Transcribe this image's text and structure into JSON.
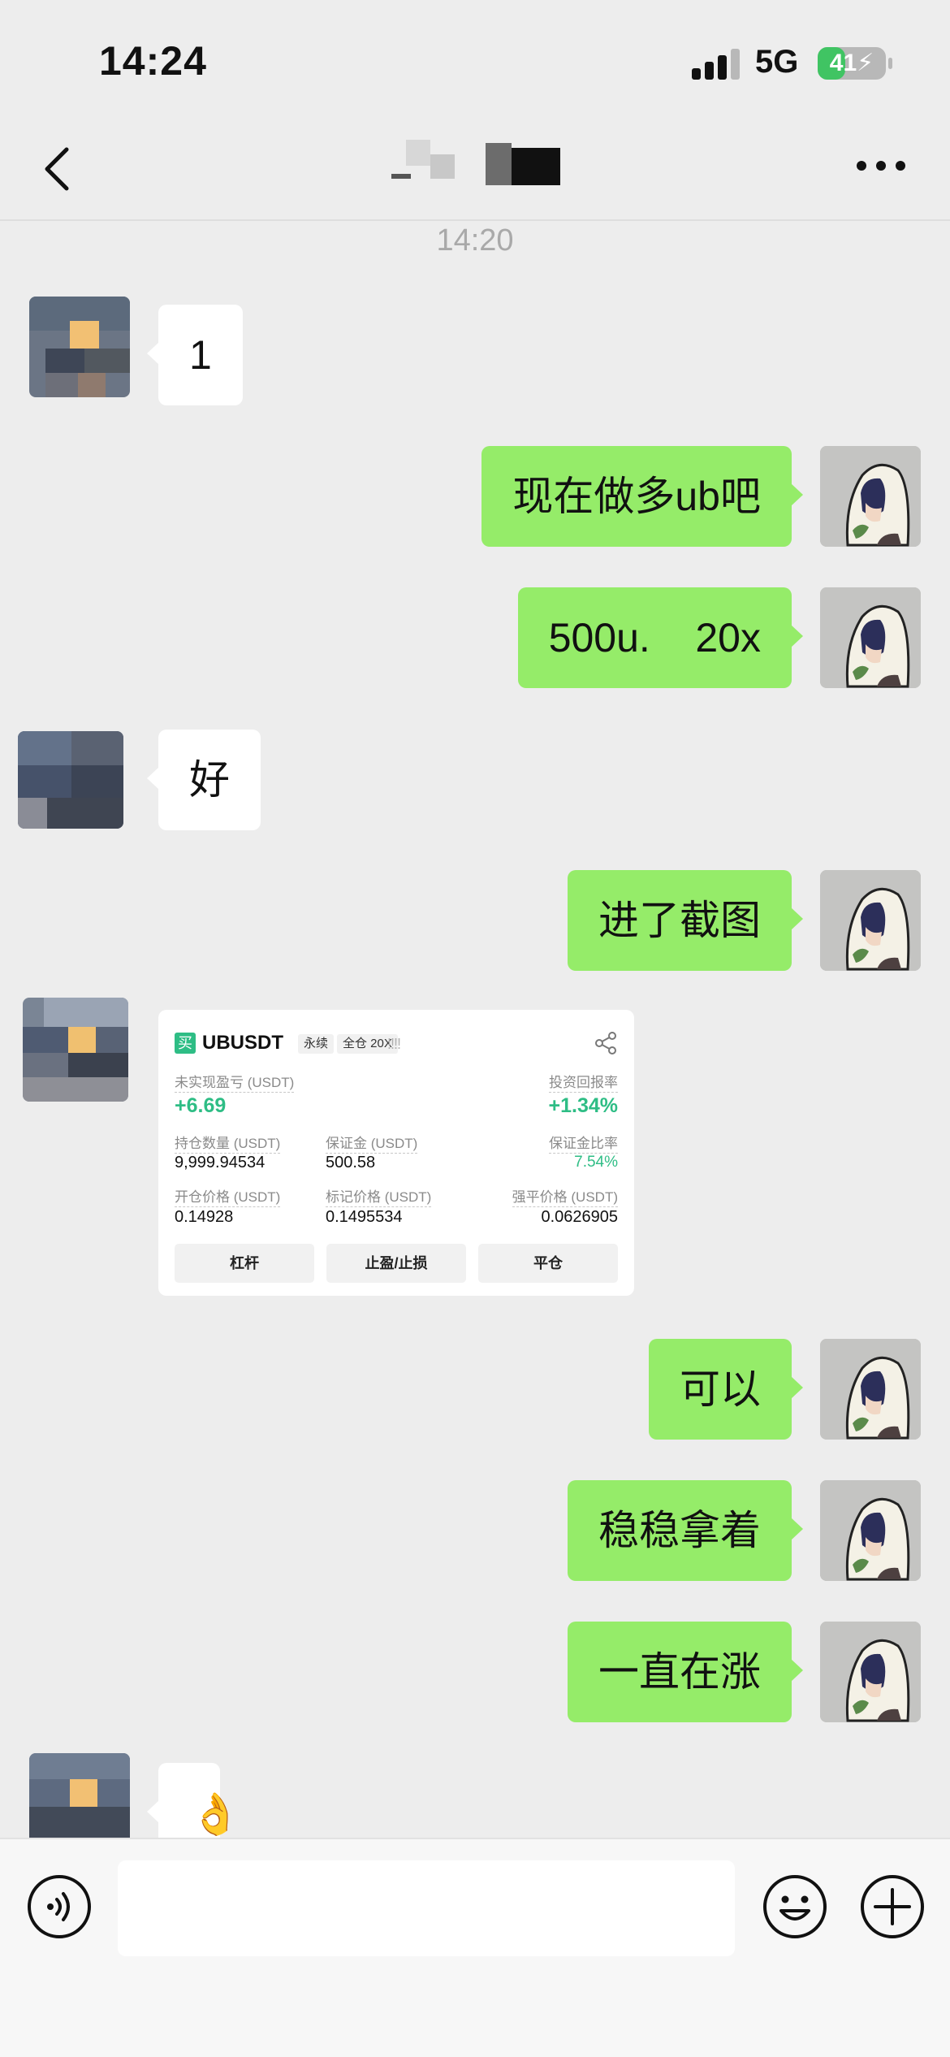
{
  "status_bar": {
    "time": "14:24",
    "network": "5G",
    "battery_level": "41",
    "battery_color": "#40c463"
  },
  "nav": {
    "back_icon": "chevron-left-icon",
    "more_icon": "more-icon"
  },
  "chat": {
    "timestamp": "14:20",
    "bubble_colors": {
      "incoming": "#ffffff",
      "outgoing": "#95ec69"
    },
    "messages": [
      {
        "side": "in",
        "text": "1"
      },
      {
        "side": "out",
        "text": "现在做多ub吧"
      },
      {
        "side": "out",
        "text": "500u.    20x"
      },
      {
        "side": "in",
        "text": "好"
      },
      {
        "side": "out",
        "text": "进了截图"
      },
      {
        "side": "in",
        "type": "image"
      },
      {
        "side": "out",
        "text": "可以"
      },
      {
        "side": "out",
        "text": "稳稳拿着"
      },
      {
        "side": "out",
        "text": "一直在涨"
      },
      {
        "side": "in",
        "text": "👌"
      }
    ]
  },
  "position_card": {
    "side_tag": "买",
    "symbol": "UBUSDT",
    "contract_type": "永续",
    "margin_mode": "全仓 20X",
    "signal_bars": "!!!!",
    "unrealized_pnl_label": "未实现盈亏 (USDT)",
    "unrealized_pnl": "+6.69",
    "roi_label": "投资回报率",
    "roi": "+1.34%",
    "position_size_label": "持仓数量 (USDT)",
    "position_size": "9,999.94534",
    "margin_label": "保证金 (USDT)",
    "margin": "500.58",
    "margin_ratio_label": "保证金比率",
    "margin_ratio": "7.54%",
    "entry_price_label": "开仓价格 (USDT)",
    "entry_price": "0.14928",
    "mark_price_label": "标记价格 (USDT)",
    "mark_price": "0.1495534",
    "liq_price_label": "强平价格 (USDT)",
    "liq_price": "0.0626905",
    "buttons": [
      "杠杆",
      "止盈/止损",
      "平仓"
    ]
  },
  "input_bar": {
    "voice_icon": "voice-icon",
    "emoji_icon": "smiley-icon",
    "plus_icon": "plus-icon",
    "text_value": ""
  }
}
